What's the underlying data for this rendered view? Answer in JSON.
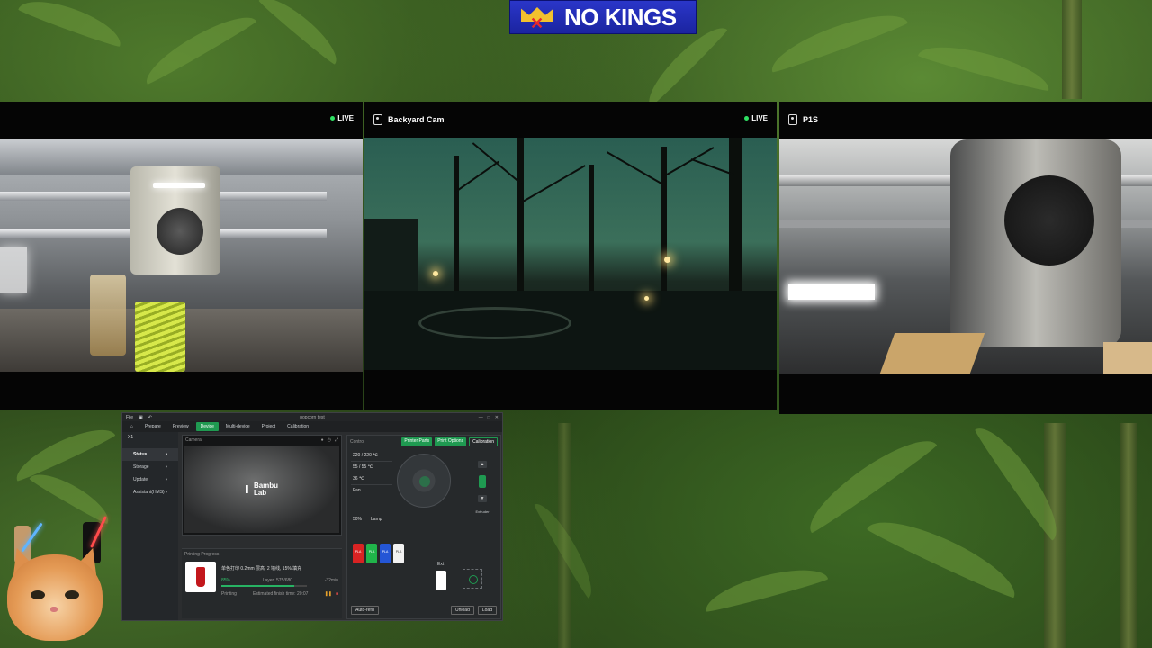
{
  "banner": {
    "text": "NO KINGS",
    "colors": {
      "background": "#2a36c9",
      "crown": "#f2c12e",
      "crown_mark": "#e6282d"
    }
  },
  "cameras": [
    {
      "title": "",
      "live_label": "LIVE",
      "live_color": "#2fe063"
    },
    {
      "title": "Backyard Cam",
      "live_label": "LIVE",
      "icon": "camera-icon"
    },
    {
      "title": "P1S",
      "icon": "camera-icon"
    }
  ],
  "studio": {
    "window_title": "popcorn test",
    "menu": {
      "file": "File"
    },
    "tabs": [
      {
        "label": "Prepare"
      },
      {
        "label": "Preview"
      },
      {
        "label": "Device",
        "active": true
      },
      {
        "label": "Multi-device"
      },
      {
        "label": "Project"
      },
      {
        "label": "Calibration"
      }
    ],
    "device_name": "X1",
    "sidebar": [
      {
        "label": "Status",
        "active": true
      },
      {
        "label": "Storage"
      },
      {
        "label": "Update"
      },
      {
        "label": "Assistant(HMS)"
      }
    ],
    "camera": {
      "label": "Camera",
      "brand_line1": "Bambu",
      "brand_line2": "Lab"
    },
    "job": {
      "section": "Printing Progress",
      "file_name": "单色打印 0.2mm 层高, 2 墙线, 15% 填充",
      "percent": "85%",
      "progress_fraction": 0.85,
      "layer": "Layer: 575/680",
      "remaining": "-32min",
      "state": "Printing",
      "estimated": "Estimated finish time: 20:07"
    },
    "control": {
      "title": "Control",
      "printer_parts": "Printer Parts",
      "print_options": "Print Options",
      "calibration": "Calibration",
      "temps": [
        "220 / 220 ℃",
        "55 / 55 ℃",
        "36 ℃"
      ],
      "fan": "Fan",
      "lamp": "Lamp",
      "fan_pct": "50%",
      "extruder": "Extruder",
      "external": "Ext",
      "auto_refill": "Auto-refill",
      "unload": "Unload",
      "load": "Load",
      "spools": [
        {
          "label": "PLA",
          "color": "#d92323"
        },
        {
          "label": "PLA",
          "color": "#20b44a"
        },
        {
          "label": "PLA",
          "color": "#2456d6"
        },
        {
          "label": "PLA",
          "color": "#f2f2f2"
        }
      ]
    }
  }
}
